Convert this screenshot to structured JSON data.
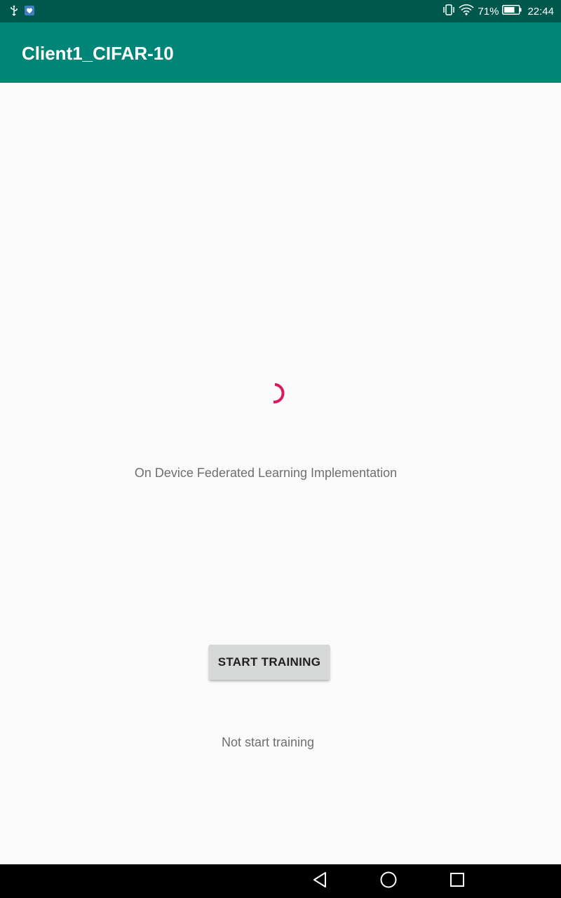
{
  "status_bar": {
    "battery": "71%",
    "time": "22:44",
    "icons": [
      "usb-icon",
      "notification-app-icon",
      "vibrate-icon",
      "wifi-icon",
      "battery-icon"
    ]
  },
  "app_bar": {
    "title": "Client1_CIFAR-10"
  },
  "main": {
    "subtitle": "On Device Federated Learning Implementation",
    "start_button_label": "START TRAINING",
    "training_status": "Not start training"
  },
  "nav_bar": {
    "icons": [
      "back-icon",
      "home-icon",
      "recents-icon"
    ]
  },
  "colors": {
    "status_bar": "#00574b",
    "app_bar": "#008577",
    "accent": "#d81b60",
    "background": "#fafafa"
  }
}
